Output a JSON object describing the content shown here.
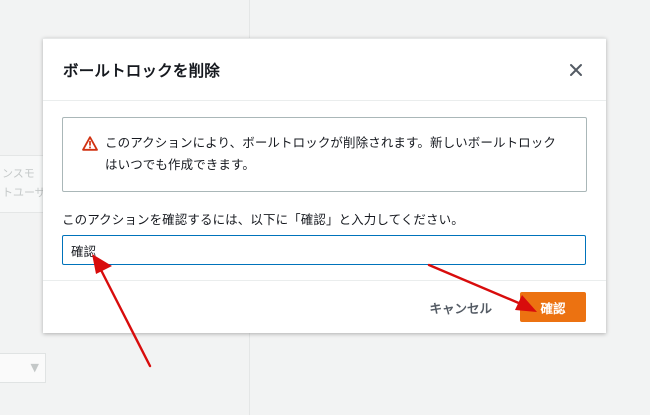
{
  "background": {
    "card_line1": "ンスモ",
    "card_line2": "トユーザ",
    "select_arrow": "▼"
  },
  "modal": {
    "title": "ボールトロックを削除",
    "close_icon": "close-icon",
    "warning": {
      "icon": "warning-triangle-icon",
      "text_line1": "このアクションにより、ボールトロックが削除されます。新しいボールトロック",
      "text_line2": "はいつでも作成できます。"
    },
    "confirm_label": "このアクションを確認するには、以下に「確認」と入力してください。",
    "confirm_input_value": "確認",
    "cancel_label": "キャンセル",
    "confirm_label_button": "確認"
  },
  "colors": {
    "accent": "#ec7211",
    "input_border": "#0073bb",
    "warning": "#d13212",
    "annotation": "#d80c0c"
  }
}
